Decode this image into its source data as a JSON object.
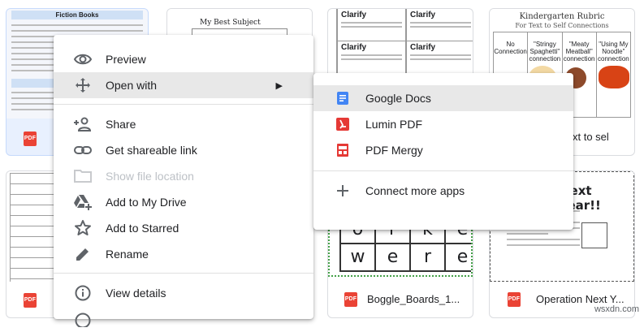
{
  "files": {
    "card1": {
      "thumb_title": "Fiction Books",
      "file_type": "PDF"
    },
    "card2": {
      "thumb_title": "My Best Subject"
    },
    "card3": {
      "thumb_word": "Clarify"
    },
    "card4": {
      "thumb_title": "Kindergarten Rubric",
      "thumb_subtitle": "For Text to Self Connections",
      "columns": [
        "No Connection",
        "\"Stringy Spaghetti\" connection",
        "\"Meaty Meatball\" connection",
        "\"Using My Noodle\" connection"
      ],
      "name": "xt to sel",
      "file_type": "PDF"
    },
    "card5": {
      "file_type": "PDF"
    },
    "card6": {
      "thumb_row1": [
        "o",
        "r",
        "k",
        "e"
      ],
      "thumb_row2": [
        "w",
        "e",
        "r",
        "e"
      ],
      "name": "Boggle_Boards_1...",
      "file_type": "PDF"
    },
    "card7": {
      "thumb_title": "Next Year!!",
      "name": "Operation Next Y...",
      "file_type": "PDF"
    }
  },
  "context_menu": {
    "items": [
      {
        "label": "Preview",
        "icon": "eye-icon"
      },
      {
        "label": "Open with",
        "icon": "move-arrows-icon",
        "arrow": "▶"
      },
      {
        "label": "Share",
        "icon": "person-add-icon"
      },
      {
        "label": "Get shareable link",
        "icon": "link-icon"
      },
      {
        "label": "Show file location",
        "icon": "folder-icon",
        "disabled": true
      },
      {
        "label": "Add to My Drive",
        "icon": "drive-add-icon"
      },
      {
        "label": "Add to Starred",
        "icon": "star-outline-icon"
      },
      {
        "label": "Rename",
        "icon": "pencil-icon"
      },
      {
        "label": "View details",
        "icon": "info-icon"
      }
    ]
  },
  "open_with_submenu": {
    "items": [
      {
        "label": "Google Docs",
        "icon": "google-docs-icon",
        "color": "#4285f4"
      },
      {
        "label": "Lumin PDF",
        "icon": "lumin-pdf-icon",
        "color": "#e53935"
      },
      {
        "label": "PDF Mergy",
        "icon": "pdf-mergy-icon",
        "color": "#e53935"
      },
      {
        "label": "Connect more apps",
        "icon": "plus-icon"
      }
    ]
  },
  "watermark": "wsxdn.com"
}
